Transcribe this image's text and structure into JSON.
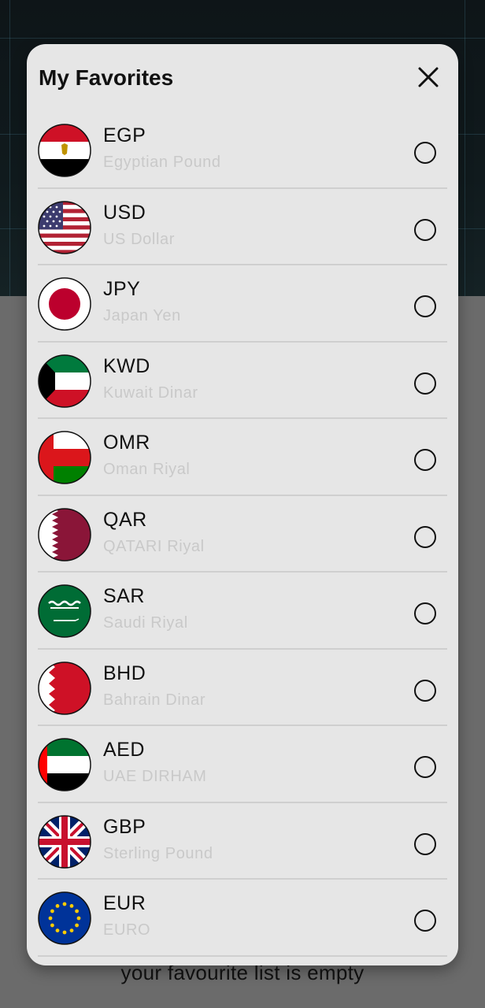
{
  "modal": {
    "title": "My Favorites",
    "close_icon": "close-icon"
  },
  "currencies": [
    {
      "code": "EGP",
      "name": "Egyptian Pound",
      "flag": "egypt-flag-icon"
    },
    {
      "code": "USD",
      "name": "US Dollar",
      "flag": "usa-flag-icon"
    },
    {
      "code": "JPY",
      "name": "Japan Yen",
      "flag": "japan-flag-icon"
    },
    {
      "code": "KWD",
      "name": "Kuwait Dinar",
      "flag": "kuwait-flag-icon"
    },
    {
      "code": "OMR",
      "name": "Oman Riyal",
      "flag": "oman-flag-icon"
    },
    {
      "code": "QAR",
      "name": "QATARI Riyal",
      "flag": "qatar-flag-icon"
    },
    {
      "code": "SAR",
      "name": "Saudi Riyal",
      "flag": "saudi-flag-icon"
    },
    {
      "code": "BHD",
      "name": "Bahrain Dinar",
      "flag": "bahrain-flag-icon"
    },
    {
      "code": "AED",
      "name": "UAE DIRHAM",
      "flag": "uae-flag-icon"
    },
    {
      "code": "GBP",
      "name": "Sterling Pound",
      "flag": "uk-flag-icon"
    },
    {
      "code": "EUR",
      "name": "EURO",
      "flag": "eu-flag-icon"
    }
  ],
  "background": {
    "empty_message": "your favourite list is empty"
  },
  "colors": {
    "modal_bg": "#e6e6e6",
    "overlay": "#6b6b6b",
    "subtitle": "#c9c9c9"
  }
}
